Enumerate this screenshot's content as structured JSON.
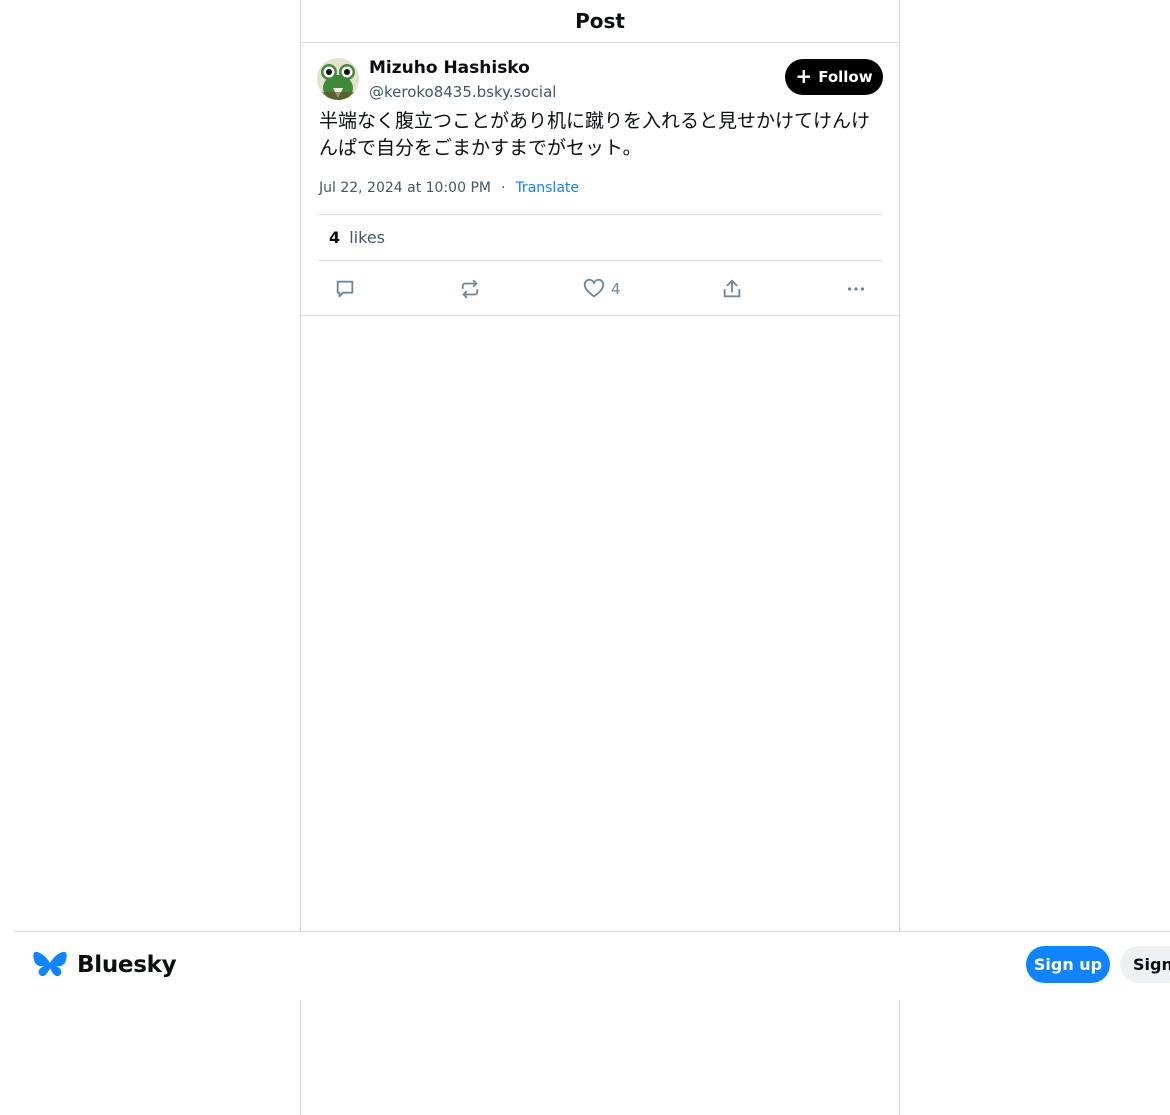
{
  "header": {
    "title": "Post"
  },
  "post": {
    "author_name": "Mizuho Hashisko",
    "author_handle": "@keroko8435.bsky.social",
    "follow_label": "Follow",
    "text": "半端なく腹立つことがあり机に蹴りを入れると見せかけてけんけんぱで自分をごまかすまでがセット。",
    "timestamp": "Jul 22, 2024 at 10:00 PM",
    "separator": "·",
    "translate_label": "Translate",
    "likes_count": "4",
    "likes_label": "likes",
    "actions": {
      "reply_icon": "reply-icon",
      "repost_icon": "repost-icon",
      "like_icon": "heart-icon",
      "like_count": "4",
      "share_icon": "share-icon",
      "more_icon": "more-icon"
    }
  },
  "bottom_bar": {
    "logo_text": "Bluesky",
    "signup_label": "Sign up",
    "signin_label": "Sign"
  },
  "colors": {
    "accent": "#1083fe",
    "text": "#0b0f14",
    "muted": "#42576c",
    "border": "#d4dbe2"
  }
}
